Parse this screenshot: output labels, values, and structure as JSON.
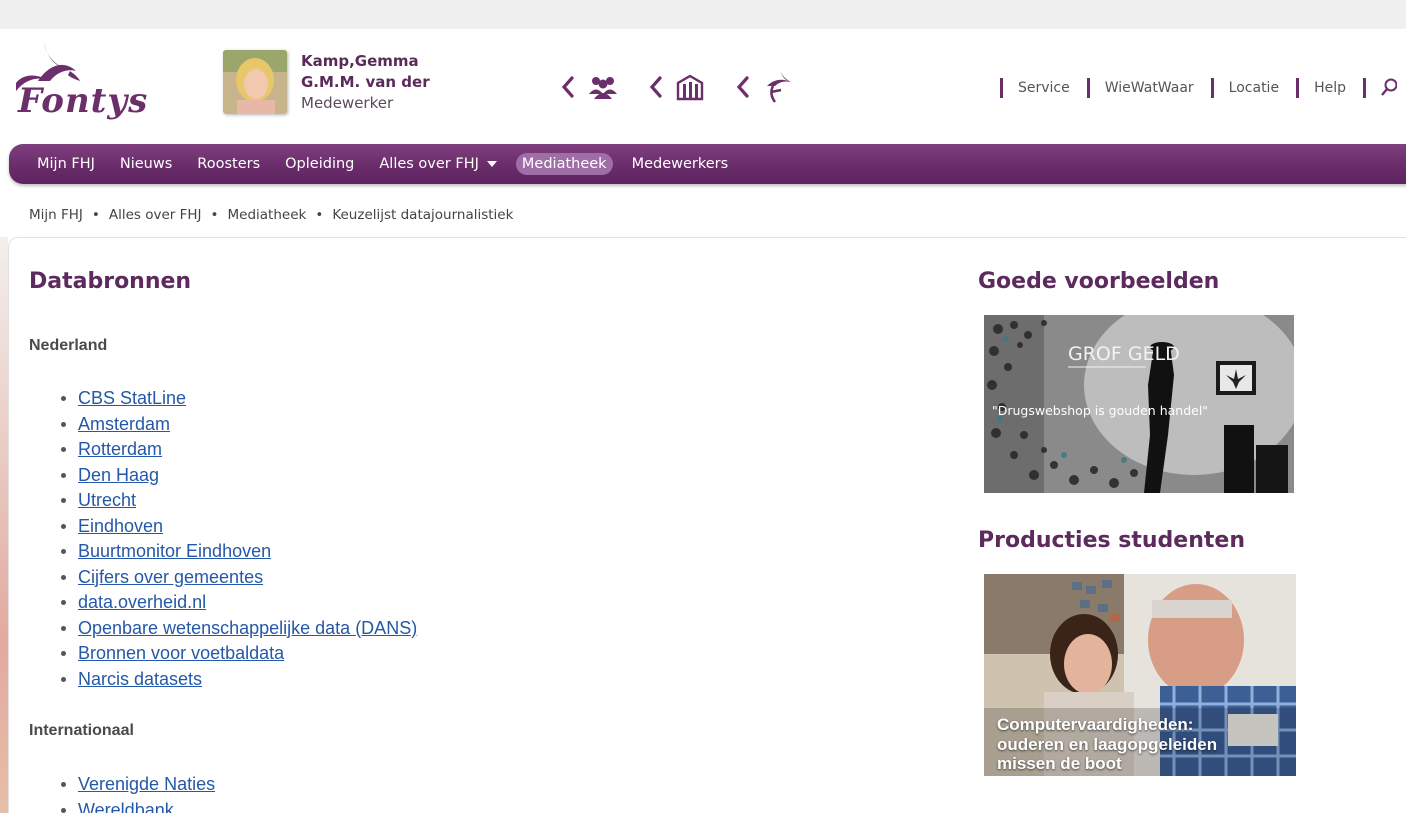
{
  "header": {
    "logo_text": "Fontys",
    "user": {
      "name_line1": "Kamp,Gemma",
      "name_line2": "G.M.M. van der",
      "role": "Medewerker"
    },
    "switcher": [
      {
        "icon": "group-icon"
      },
      {
        "icon": "building-icon"
      },
      {
        "icon": "fontys-bird-icon"
      }
    ],
    "util_nav": [
      "Service",
      "WieWatWaar",
      "Locatie",
      "Help"
    ]
  },
  "nav": {
    "items": [
      {
        "label": "Mijn FHJ"
      },
      {
        "label": "Nieuws"
      },
      {
        "label": "Roosters"
      },
      {
        "label": "Opleiding"
      },
      {
        "label": "Alles over FHJ"
      },
      {
        "label": "Mediatheek"
      },
      {
        "label": "Medewerkers"
      }
    ]
  },
  "breadcrumb": [
    "Mijn FHJ",
    "Alles over FHJ",
    "Mediatheek",
    "Keuzelijst datajournalistiek"
  ],
  "main": {
    "title": "Databronnen",
    "sections": [
      {
        "heading": "Nederland",
        "links": [
          "CBS StatLine",
          "Amsterdam",
          "Rotterdam",
          "Den Haag",
          "Utrecht",
          "Eindhoven",
          "Buurtmonitor Eindhoven",
          "Cijfers over gemeentes",
          "data.overheid.nl",
          "Openbare wetenschappelijke data (DANS)",
          "Bronnen voor voetbaldata",
          "Narcis datasets"
        ]
      },
      {
        "heading": "Internationaal",
        "links": [
          "Verenigde Naties",
          "Wereldbank"
        ]
      }
    ]
  },
  "sidebar": {
    "good_examples": {
      "title": "Goede voorbeelden",
      "image_title": "GROF GELD",
      "image_caption": "\"Drugswebshop is gouden handel\""
    },
    "student_productions": {
      "title": "Producties studenten",
      "caption_line1": "Computervaardigheden:",
      "caption_line2": "ouderen en laagopgeleiden",
      "caption_line3": "missen de boot"
    }
  },
  "colors": {
    "brand_purple": "#6b2f6b",
    "link_blue": "#2458a8",
    "nav_active": "#a06ea6"
  }
}
